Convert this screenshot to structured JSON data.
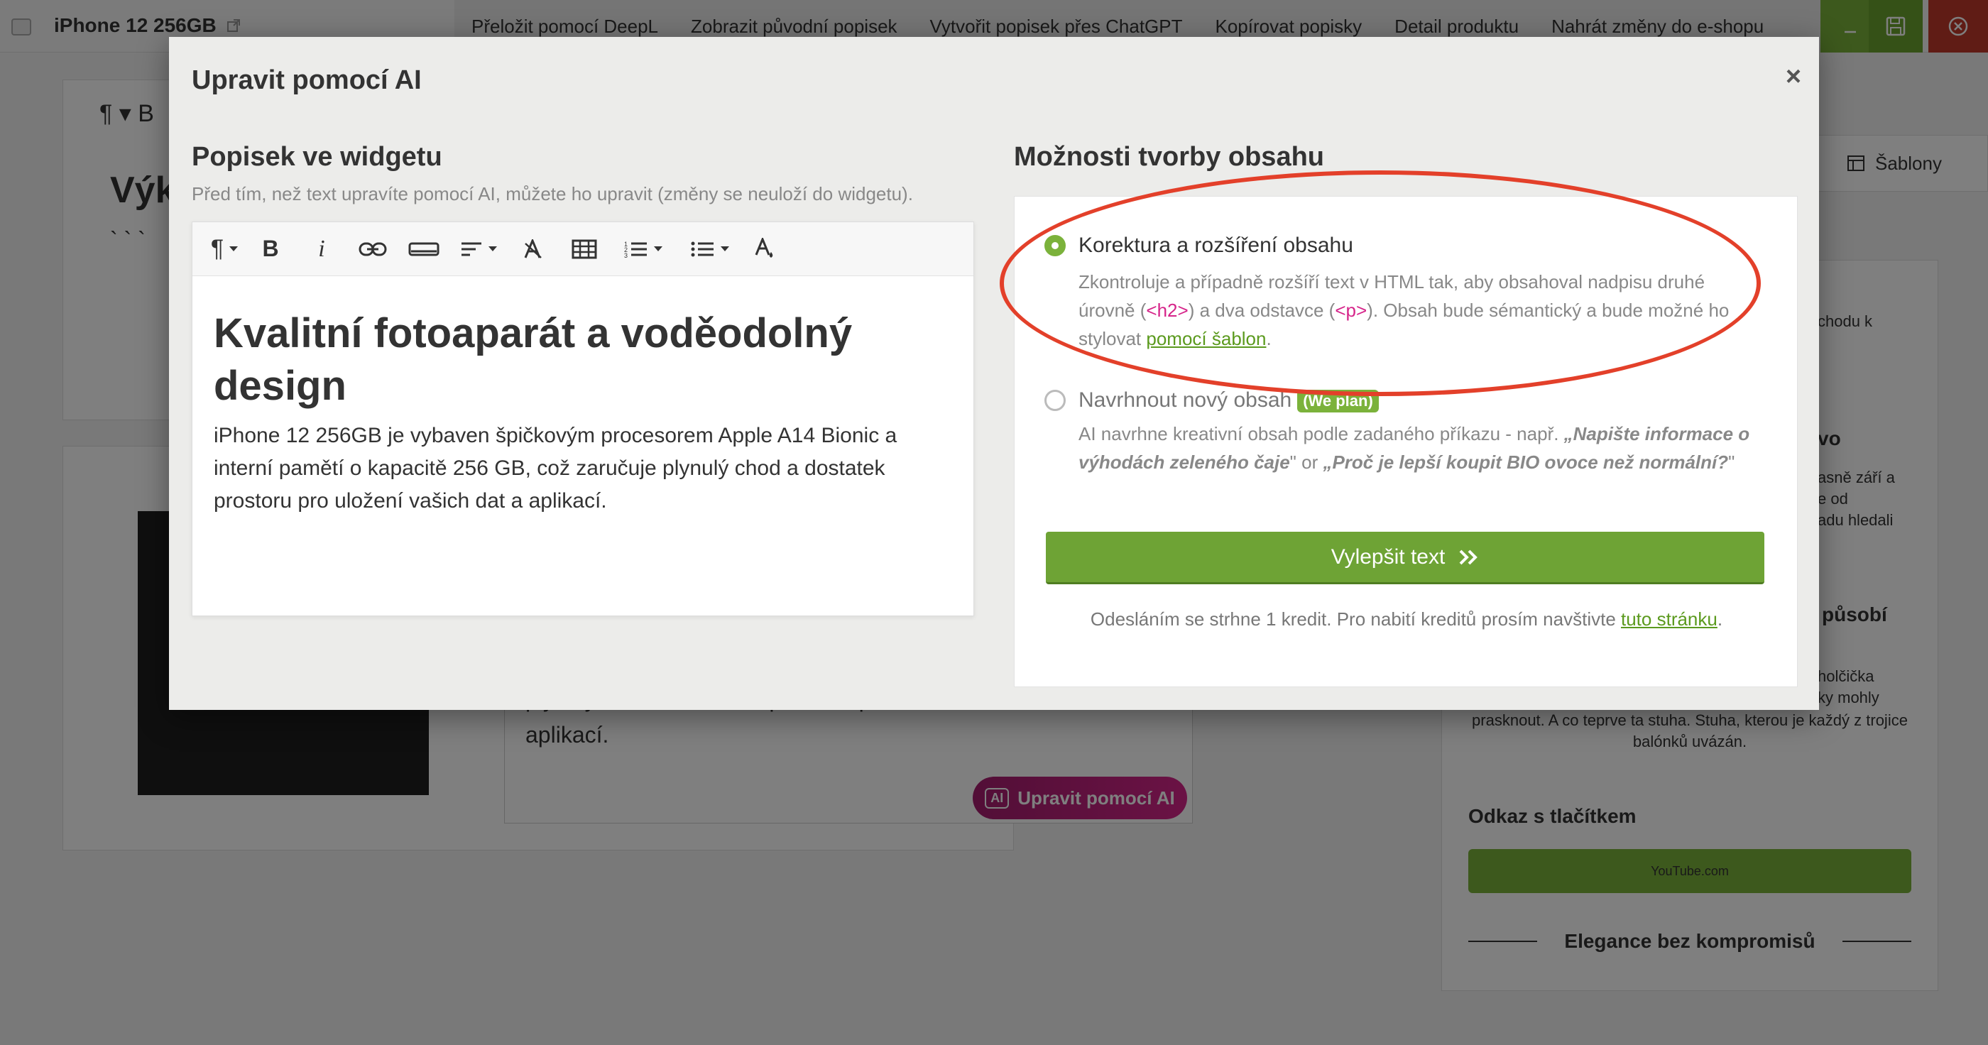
{
  "background": {
    "product_title": "iPhone 12 256GB",
    "toolbar": [
      "Přeložit pomocí DeepL",
      "Zobrazit původní popisek",
      "Vytvořit popisek přes ChatGPT",
      "Kopírovat popisky",
      "Detail produktu",
      "Nahrát změny do e-shopu"
    ],
    "editor_fragment": "Výk",
    "editor_dots": "` ` `",
    "text_fragment_1": "plynulý chod a dostatek prostoru pro uložení vašich dat a",
    "text_fragment_2": "aplikací.",
    "ai_button_label": "Upravit pomocí AI",
    "ai_badge": "AI",
    "sablony_label": "Šablony",
    "right_fragments": {
      "a": "chodu k",
      "b": "vo",
      "c": "asně září a",
      "d": "e od",
      "e": "adu hledali",
      "f": "působí",
      "g": "holčička",
      "h": "ky mohly"
    },
    "right_center_text": "prasknout. A co teprve ta stuha. Stuha, kterou je každý z trojice balónků uvázán.",
    "link_title": "Odkaz s tlačítkem",
    "youtube_label": "YouTube.com",
    "elegance_label": "Elegance bez kompromisů"
  },
  "modal": {
    "title": "Upravit pomocí AI",
    "close_icon": "close-icon",
    "left": {
      "title": "Popisek ve widgetu",
      "subtitle": "Před tím, než text upravíte pomocí AI, můžete ho upravit (změny se neuloží do widgetu).",
      "toolbar_icons": [
        "paragraph-icon",
        "bold-icon",
        "italic-icon",
        "link-icon",
        "button-icon",
        "align-icon",
        "clear-format-icon",
        "table-icon",
        "ordered-list-icon",
        "unordered-list-icon",
        "text-color-icon"
      ],
      "heading": "Kvalitní fotoaparát a voděodolný design",
      "paragraph": "iPhone 12 256GB je vybaven špičkovým procesorem Apple A14 Bionic a interní pamětí o kapacitě 256 GB, což zaručuje plynulý chod a dostatek prostoru pro uložení vašich dat a aplikací."
    },
    "right": {
      "title": "Možnosti tvorby obsahu",
      "option1": {
        "label": "Korektura a rozšíření obsahu",
        "desc_1": "Zkontroluje a případně rozšíří text v HTML tak, aby obsahoval nadpisu druhé úrovně (",
        "code_h2": "<h2>",
        "desc_2": ") a dva odstavce (",
        "code_p": "<p>",
        "desc_3": "). Obsah bude sémantický a bude možné ho stylovat ",
        "link": "pomocí šablon",
        "desc_4": ".",
        "selected": true
      },
      "option2": {
        "label": "Navrhnout nový obsah",
        "badge": "(We plan)",
        "desc_1": "AI navrhne kreativní obsah podle zadaného příkazu - např. ",
        "example_1": "„Napište informace o výhodách zeleného čaje",
        "desc_2": "\" or ",
        "example_2": "„Proč je lepší koupit BIO ovoce než normální?",
        "desc_3": "\"",
        "selected": false
      },
      "submit_label": "Vylepšit text",
      "note_1": "Odesláním se strhne 1 kredit. Pro nabití kreditů prosím navštivte ",
      "note_link": "tuto stránku",
      "note_2": "."
    }
  },
  "colors": {
    "accent_green": "#6ea335",
    "highlight_red": "#e3402a",
    "code_pink": "#d6258a"
  }
}
